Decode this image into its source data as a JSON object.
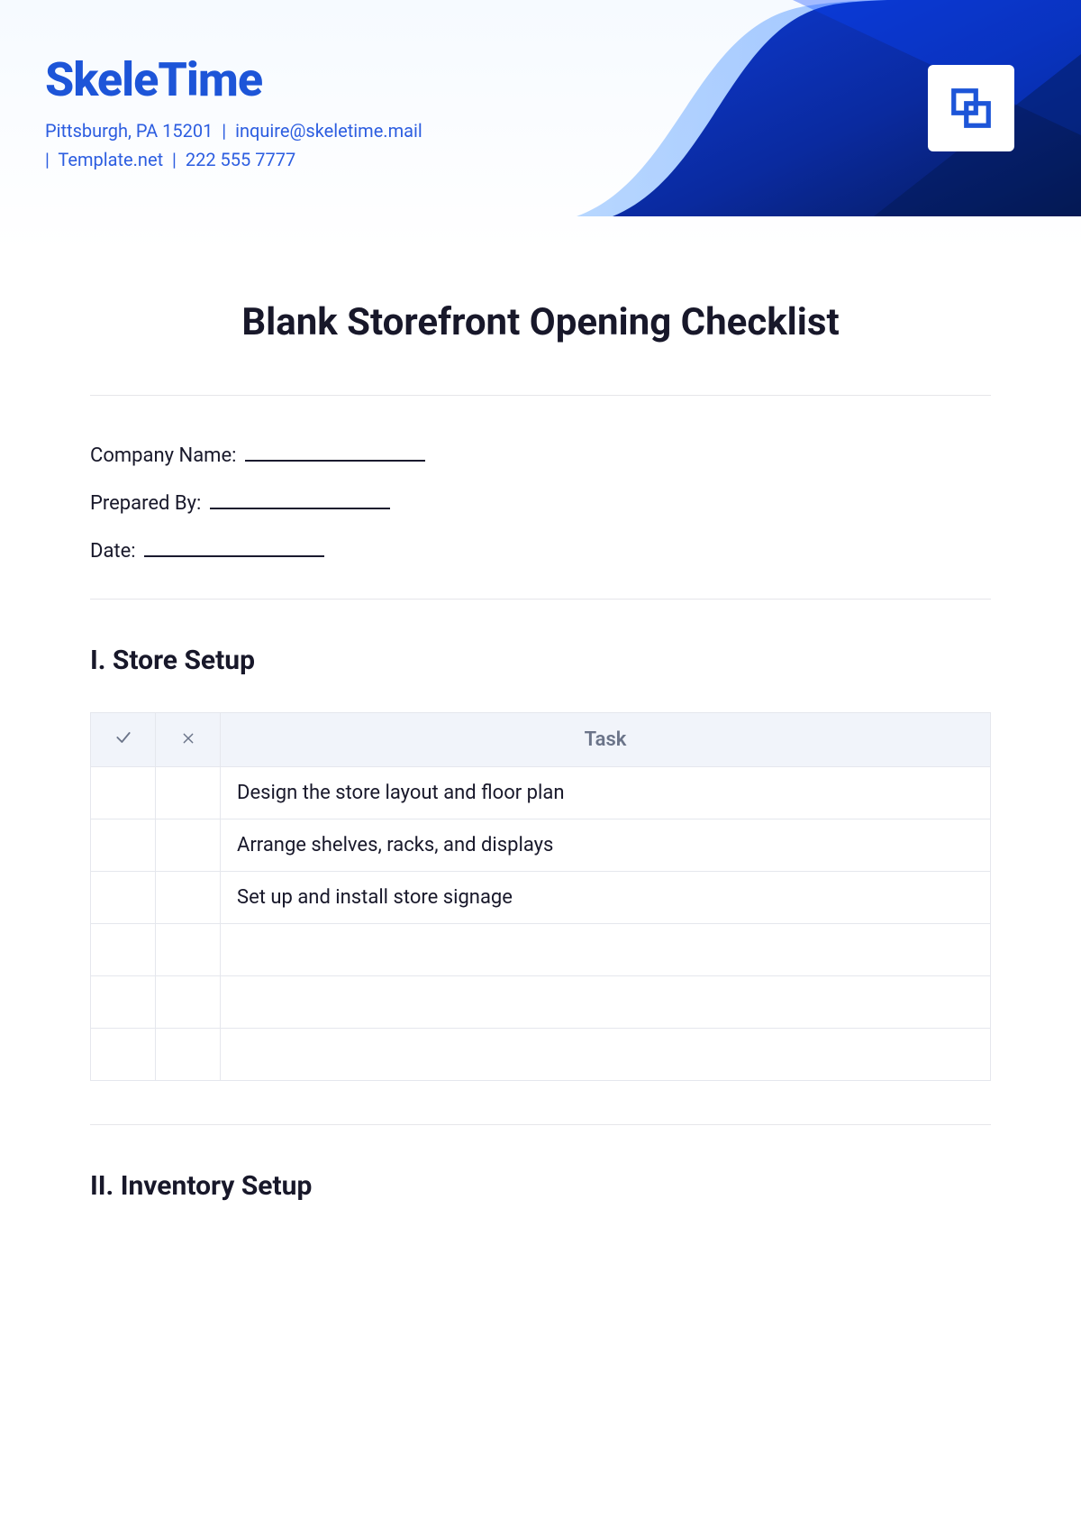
{
  "brand": {
    "name": "SkeleTime",
    "address": "Pittsburgh, PA 15201",
    "email": "inquire@skeletime.mail",
    "site": "Template.net",
    "phone": "222 555 7777",
    "icon": "overlap-squares-icon"
  },
  "doc": {
    "title": "Blank Storefront Opening Checklist",
    "fields": {
      "company_name_label": "Company Name:",
      "prepared_by_label": "Prepared By:",
      "date_label": "Date:"
    }
  },
  "sections": [
    {
      "heading": "I. Store Setup",
      "columns": {
        "check": "✓",
        "cross": "✕",
        "task": "Task"
      },
      "rows": [
        {
          "task": "Design the store layout and floor plan"
        },
        {
          "task": "Arrange shelves, racks, and displays"
        },
        {
          "task": "Set up and install store signage"
        },
        {
          "task": ""
        },
        {
          "task": ""
        },
        {
          "task": ""
        }
      ]
    },
    {
      "heading": "II. Inventory Setup"
    }
  ],
  "colors": {
    "brand_blue": "#1d55d8",
    "deep_blue": "#0b2a86",
    "table_header_bg": "#f1f4fa",
    "border": "#e5e7ed"
  }
}
